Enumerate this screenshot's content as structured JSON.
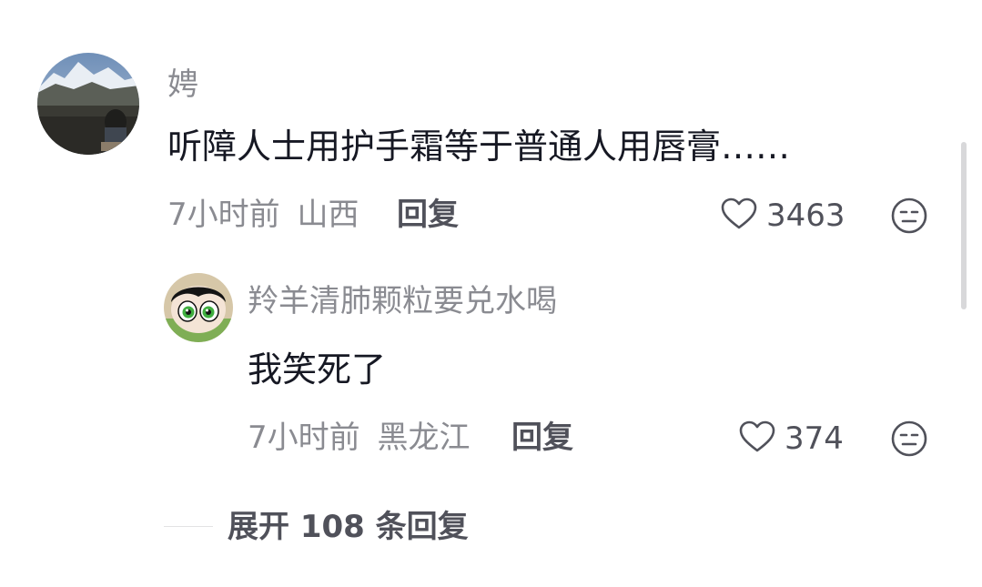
{
  "comment": {
    "username": "娉",
    "text": "听障人士用护手霜等于普通人用唇膏……",
    "time": "7小时前",
    "location": "山西",
    "reply_label": "回复",
    "like_count": "3463",
    "avatar_icon": "avatar-mountain-photo"
  },
  "reply": {
    "username": "羚羊清肺颗粒要兑水喝",
    "text": "我笑死了",
    "time": "7小时前",
    "location": "黑龙江",
    "reply_label": "回复",
    "like_count": "374",
    "avatar_icon": "avatar-cartoon-girl"
  },
  "expand": {
    "label": "展开 108 条回复"
  },
  "icons": {
    "like": "heart-outline-icon",
    "dislike": "unamused-face-icon"
  },
  "colors": {
    "primary_text": "#161823",
    "secondary_text": "#8a8b91",
    "action_text": "#50515a"
  }
}
